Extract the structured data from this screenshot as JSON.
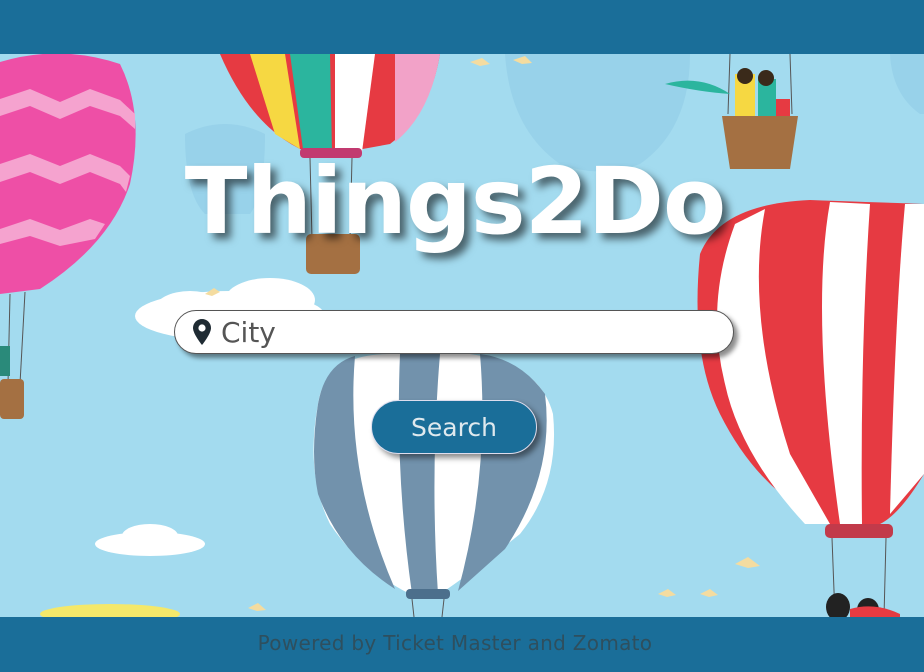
{
  "app": {
    "title": "Things2Do"
  },
  "search": {
    "placeholder": "City",
    "value": "",
    "location_icon": "map-pin-icon"
  },
  "actions": {
    "search_label": "Search"
  },
  "footer": {
    "text": "Powered by Ticket Master and Zomato"
  },
  "colors": {
    "primary": "#1a6e99",
    "sky": "#a3dbef",
    "title": "#ffffff",
    "footer_text": "#2e4f5e"
  }
}
